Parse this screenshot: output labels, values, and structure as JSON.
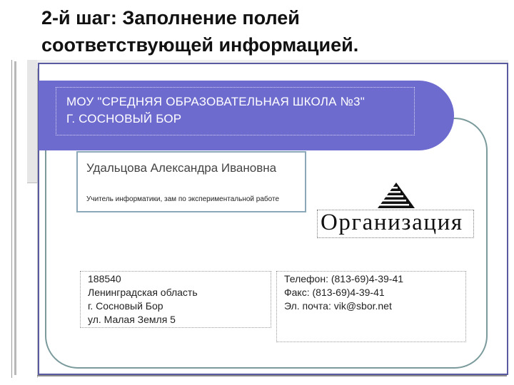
{
  "slide": {
    "title_line1": "2-й шаг: Заполнение полей",
    "title_line2": "соответствующей информацией."
  },
  "card": {
    "header": {
      "line1": "МОУ \"СРЕДНЯЯ ОБРАЗОВАТЕЛЬНАЯ ШКОЛА №3\"",
      "line2": "Г. СОСНОВЫЙ БОР"
    },
    "person": {
      "name": "Удальцова Александра Ивановна",
      "role": "Учитель информатики, зам по экспериментальной работе"
    },
    "organization": "Организация",
    "address": [
      "188540",
      "Ленинградская область",
      "г. Сосновый Бор",
      "ул. Малая Земля 5"
    ],
    "contacts": [
      "Телефон: (813-69)4-39-41",
      "Факс: (813-69)4-39-41",
      "Эл. почта: vik@sbor.net"
    ]
  },
  "colors": {
    "header_band": "#6e6bcf",
    "frame_border": "#7a9a9c",
    "header_text": "#ffffff"
  },
  "icons": {
    "logo": "pyramid-stripes-icon"
  }
}
